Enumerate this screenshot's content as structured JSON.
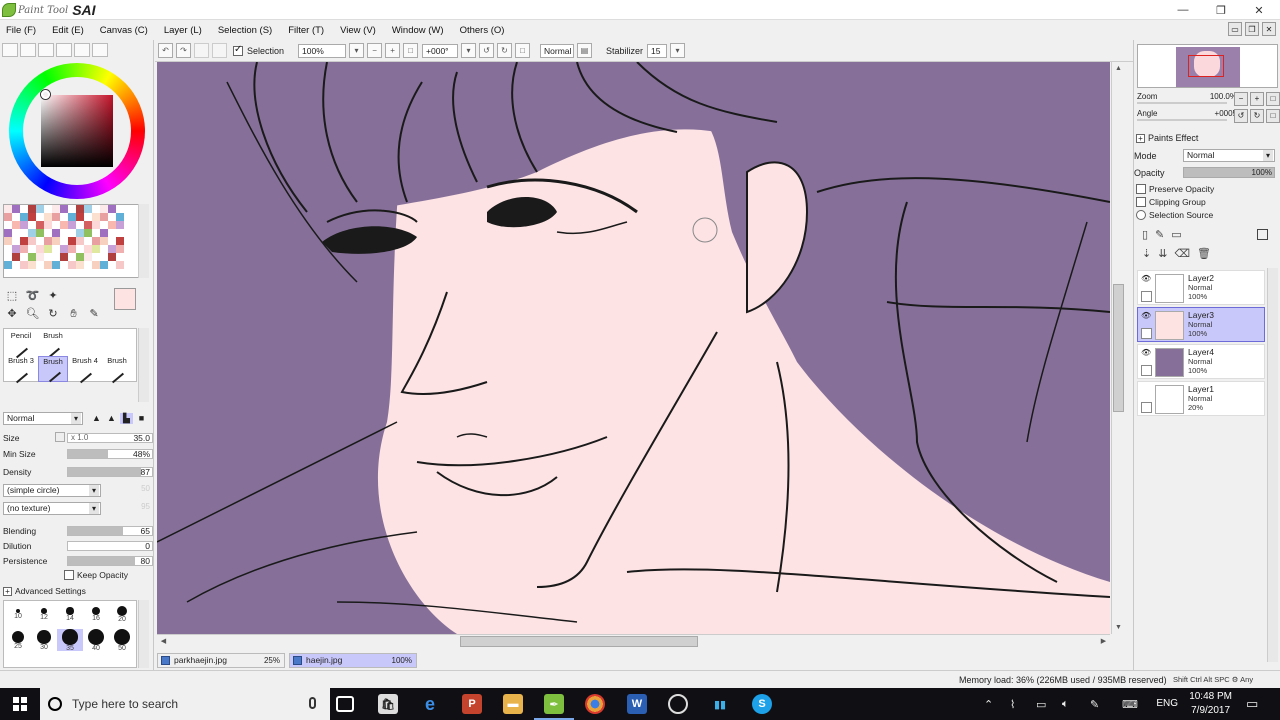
{
  "app": {
    "logo_text": "Paint Tool",
    "logo_brand": "SAI",
    "window_controls": [
      "—",
      "❐",
      "✕"
    ]
  },
  "menu": {
    "items": [
      "File (F)",
      "Edit (E)",
      "Canvas (C)",
      "Layer (L)",
      "Selection (S)",
      "Filter (T)",
      "View (V)",
      "Window (W)",
      "Others (O)"
    ]
  },
  "canvas_toolbar": {
    "selection_label": "Selection",
    "selection_checked": true,
    "zoom": "100%",
    "rotation": "+000°",
    "mode": "Normal",
    "stabilizer_label": "Stabilizer",
    "stabilizer_value": "15"
  },
  "brush_tools": {
    "slots": [
      "Pencil",
      "Brush",
      "Brush 3",
      "Brush",
      "Brush 4",
      "Brush"
    ],
    "selected_index": 3
  },
  "brush_props": {
    "blend_mode": "Normal",
    "size_label": "Size",
    "size_multiplier": "x 1.0",
    "size_value": "35.0",
    "min_size_label": "Min Size",
    "min_size_value": "48%",
    "min_size_fraction": 0.48,
    "density_label": "Density",
    "density_value": "87",
    "density_fraction": 0.87,
    "shape": "(simple circle)",
    "shape_value": "50",
    "texture": "(no texture)",
    "texture_value": "95",
    "blending_label": "Blending",
    "blending_value": "65",
    "blending_fraction": 0.65,
    "dilution_label": "Dilution",
    "dilution_value": "0",
    "dilution_fraction": 0,
    "persistence_label": "Persistence",
    "persistence_value": "80",
    "persistence_fraction": 0.8,
    "keep_opacity_label": "Keep Opacity",
    "advanced_label": "Advanced Settings"
  },
  "brush_sizes": [
    "10",
    "12",
    "14",
    "16",
    "20",
    "25",
    "30",
    "35",
    "40",
    "50"
  ],
  "brush_sizes_selected": "35",
  "colors": {
    "fg": "#fde4e2",
    "canvas_bg": "#86709a",
    "selection": "#c9c8fb"
  },
  "navigator": {
    "zoom_label": "Zoom",
    "zoom_value": "100.0%",
    "angle_label": "Angle",
    "angle_value": "+0005"
  },
  "layers_panel": {
    "paints_effect_label": "Paints Effect",
    "mode_label": "Mode",
    "mode_value": "Normal",
    "opacity_label": "Opacity",
    "opacity_value": "100%",
    "preserve_opacity_label": "Preserve Opacity",
    "clipping_group_label": "Clipping Group",
    "selection_source_label": "Selection Source",
    "layers": [
      {
        "name": "Layer2",
        "mode": "Normal",
        "opacity": "100%",
        "visible": true,
        "selected": false
      },
      {
        "name": "Layer3",
        "mode": "Normal",
        "opacity": "100%",
        "visible": true,
        "selected": true
      },
      {
        "name": "Layer4",
        "mode": "Normal",
        "opacity": "100%",
        "visible": true,
        "selected": false
      },
      {
        "name": "Layer1",
        "mode": "Normal",
        "opacity": "20%",
        "visible": false,
        "selected": false
      }
    ]
  },
  "documents": [
    {
      "name": "parkhaejin.jpg",
      "zoom": "25%",
      "active": false
    },
    {
      "name": "haejin.jpg",
      "zoom": "100%",
      "active": true
    }
  ],
  "status": {
    "memory": "Memory load: 36% (226MB used / 935MB reserved)",
    "keys": "Shift Ctrl Alt SPC ⚙ Any"
  },
  "taskbar": {
    "search_placeholder": "Type here to search",
    "lang": "ENG",
    "time": "10:48 PM",
    "date": "7/9/2017"
  }
}
